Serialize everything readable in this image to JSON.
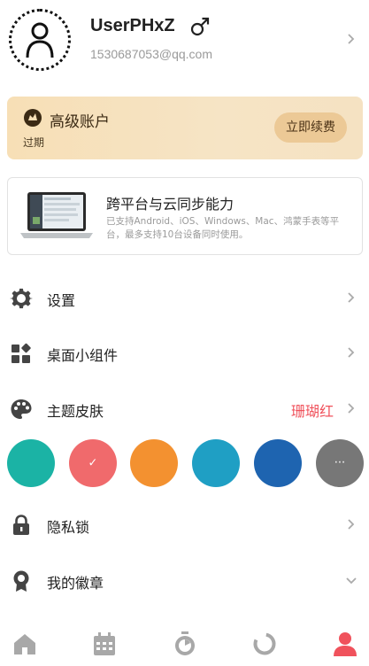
{
  "profile": {
    "username": "UserPHxZ",
    "gender_symbol": "♂",
    "email": "1530687053@qq.com"
  },
  "premium": {
    "title": "高级账户",
    "status": "过期",
    "renew_label": "立即续费"
  },
  "sync": {
    "title": "跨平台与云同步能力",
    "description": "已支持Android、iOS、Windows、Mac、鸿蒙手表等平台，最多支持10台设备同时使用。"
  },
  "menu": {
    "settings": "设置",
    "widgets": "桌面小组件",
    "theme": "主题皮肤",
    "theme_value": "珊瑚红",
    "privacy": "隐私锁",
    "badges": "我的徽章"
  },
  "theme_swatches": {
    "colors": [
      "#1bb3a5",
      "#f06a6c",
      "#f39130",
      "#1f9fc4",
      "#1e64b0",
      "#777777"
    ],
    "selected_mark": "✓",
    "more_mark": "···"
  },
  "colors": {
    "accent": "#f0525c",
    "premium_bg": "#f7dfb6",
    "renew_bg": "#ecc996",
    "icon_gray": "#444444",
    "nav_gray": "#a8a8a8"
  },
  "icons": {
    "avatar": "user-outline-icon",
    "crown": "crown-icon",
    "settings": "gear-icon",
    "widgets": "widgets-icon",
    "theme": "palette-icon",
    "privacy": "lock-icon",
    "badges": "badge-ribbon-icon",
    "nav": [
      "home-icon",
      "calendar-icon",
      "timer-icon",
      "stats-ring-icon",
      "profile-icon"
    ]
  }
}
